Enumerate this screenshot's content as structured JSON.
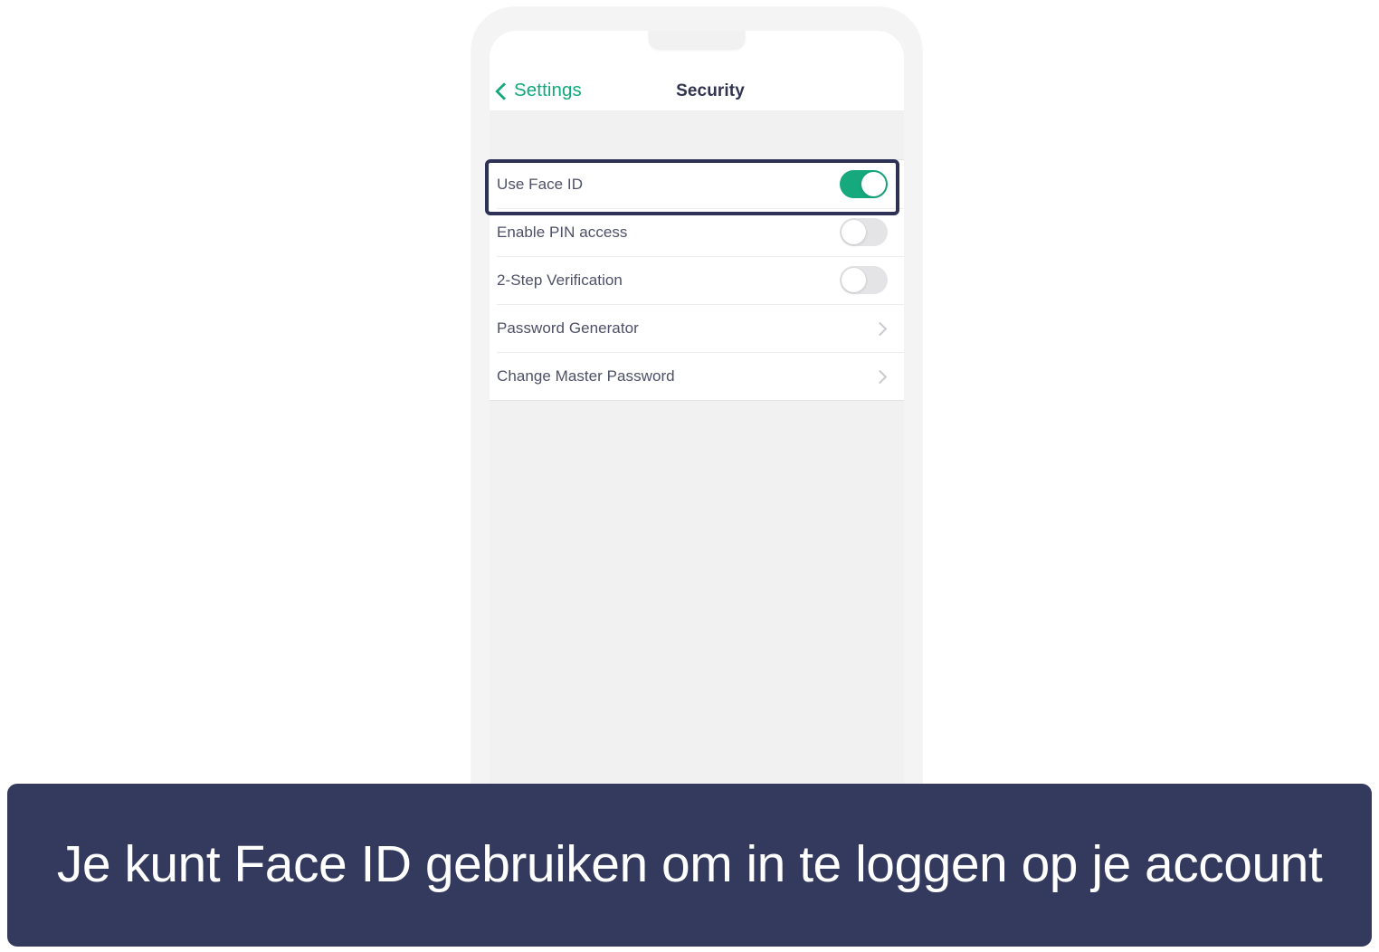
{
  "phone": {
    "navbar": {
      "back_label": "Settings",
      "back_icon": "chevron-left-icon",
      "title": "Security"
    },
    "settings_list": [
      {
        "label": "Use Face ID",
        "control": "toggle",
        "state": "on",
        "highlighted": true
      },
      {
        "label": "Enable PIN access",
        "control": "toggle",
        "state": "off",
        "highlighted": false
      },
      {
        "label": "2-Step Verification",
        "control": "toggle",
        "state": "off",
        "highlighted": false
      },
      {
        "label": "Password Generator",
        "control": "disclosure",
        "state": "",
        "highlighted": false
      },
      {
        "label": "Change Master Password",
        "control": "disclosure",
        "state": "",
        "highlighted": false
      }
    ]
  },
  "caption": {
    "text": "Je kunt Face ID gebruiken om in te loggen op je account"
  },
  "colors": {
    "accent_green": "#16a97d",
    "caption_bg": "#333a5e",
    "highlight_border": "#2e3156",
    "title_navy": "#31344f",
    "label_slate": "#4d5068",
    "screen_gray": "#f1f1f2",
    "frame_gray": "#f4f4f5"
  }
}
